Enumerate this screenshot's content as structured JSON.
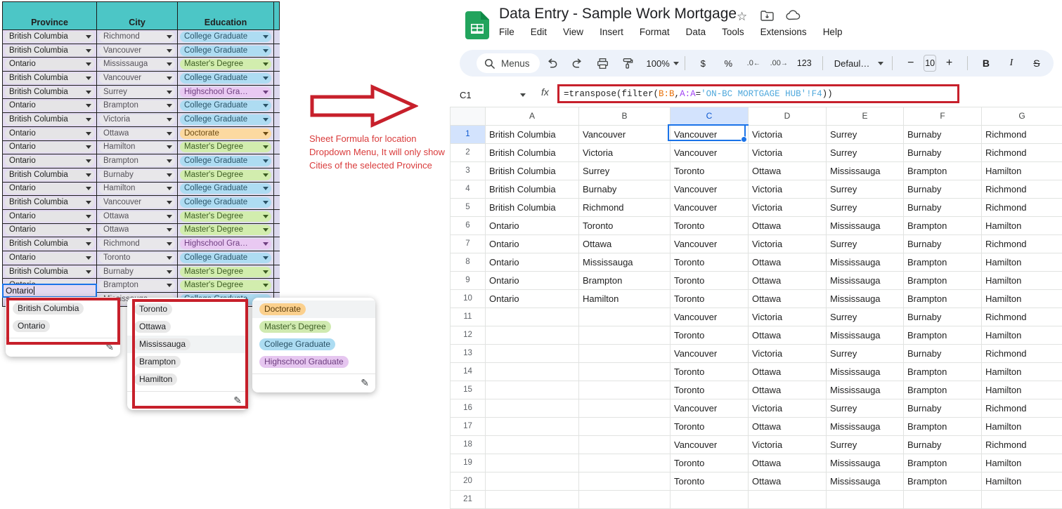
{
  "form_table": {
    "headers": [
      "Province",
      "City",
      "Education"
    ],
    "rows": [
      {
        "province": "British Columbia",
        "city": "Richmond",
        "education": "College Graduate",
        "edu_color": "blue"
      },
      {
        "province": "British Columbia",
        "city": "Vancouver",
        "education": "College Graduate",
        "edu_color": "blue"
      },
      {
        "province": "Ontario",
        "city": "Mississauga",
        "education": "Master's Degree",
        "edu_color": "green"
      },
      {
        "province": "British Columbia",
        "city": "Vancouver",
        "education": "College Graduate",
        "edu_color": "blue"
      },
      {
        "province": "British Columbia",
        "city": "Surrey",
        "education": "Highschool Gra…",
        "edu_color": "purple"
      },
      {
        "province": "Ontario",
        "city": "Brampton",
        "education": "College Graduate",
        "edu_color": "blue"
      },
      {
        "province": "British Columbia",
        "city": "Victoria",
        "education": "College Graduate",
        "edu_color": "blue"
      },
      {
        "province": "Ontario",
        "city": "Ottawa",
        "education": "Doctorate",
        "edu_color": "orange"
      },
      {
        "province": "Ontario",
        "city": "Hamilton",
        "education": "Master's Degree",
        "edu_color": "green"
      },
      {
        "province": "Ontario",
        "city": "Brampton",
        "education": "College Graduate",
        "edu_color": "blue"
      },
      {
        "province": "British Columbia",
        "city": "Burnaby",
        "education": "Master's Degree",
        "edu_color": "green"
      },
      {
        "province": "Ontario",
        "city": "Hamilton",
        "education": "College Graduate",
        "edu_color": "blue"
      },
      {
        "province": "British Columbia",
        "city": "Vancouver",
        "education": "College Graduate",
        "edu_color": "blue"
      },
      {
        "province": "Ontario",
        "city": "Ottawa",
        "education": "Master's Degree",
        "edu_color": "green"
      },
      {
        "province": "Ontario",
        "city": "Ottawa",
        "education": "Master's Degree",
        "edu_color": "green"
      },
      {
        "province": "British Columbia",
        "city": "Richmond",
        "education": "Highschool Gra…",
        "edu_color": "purple"
      },
      {
        "province": "Ontario",
        "city": "Toronto",
        "education": "College Graduate",
        "edu_color": "blue"
      },
      {
        "province": "British Columbia",
        "city": "Burnaby",
        "education": "Master's Degree",
        "edu_color": "green"
      },
      {
        "province": "Ontario",
        "city": "Brampton",
        "education": "Master's Degree",
        "edu_color": "green"
      }
    ],
    "editing_row": {
      "province_value": "Ontario",
      "city": "Mississauga",
      "education": "College Graduate",
      "edu_color": "blue"
    }
  },
  "province_dropdown": {
    "options": [
      "British Columbia",
      "Ontario"
    ],
    "highlighted_index": -1
  },
  "city_dropdown": {
    "options": [
      "Toronto",
      "Ottawa",
      "Mississauga",
      "Brampton",
      "Hamilton"
    ],
    "highlighted_index": 2
  },
  "education_dropdown": {
    "options": [
      {
        "label": "Doctorate",
        "color": "orange"
      },
      {
        "label": "Master's Degree",
        "color": "green"
      },
      {
        "label": "College Graduate",
        "color": "blue"
      },
      {
        "label": "Highschool Graduate",
        "color": "purple"
      }
    ],
    "highlighted_index": 0
  },
  "annotation": {
    "text": "Sheet Formula for location Dropdown Menu, It will only show Cities of the selected Province",
    "color": "#D93B3B"
  },
  "sheets": {
    "doc_title": "Data Entry - Sample Work Mortgage",
    "title_icons": [
      "star-icon",
      "move-to-folder-icon",
      "cloud-saved-icon"
    ],
    "menus": [
      "File",
      "Edit",
      "View",
      "Insert",
      "Format",
      "Data",
      "Tools",
      "Extensions",
      "Help"
    ],
    "toolbar": {
      "search_label": "Menus",
      "undo": "undo-icon",
      "redo": "redo-icon",
      "print": "print-icon",
      "paint_format": "paint-format-icon",
      "zoom": "100%",
      "currency": "$",
      "percent": "%",
      "decrease_decimal": ".0",
      "increase_decimal": ".00",
      "number_format": "123",
      "font": "Defaul…",
      "decrease_font": "−",
      "font_size": "10",
      "increase_font": "+",
      "bold": "B",
      "italic": "I",
      "strikethrough": "S"
    },
    "name_box": "C1",
    "fx_label": "fx",
    "formula": {
      "full": "=transpose(filter(B:B,A:A='ON-BC MORTGAGE HUB'!F4))",
      "parts": [
        {
          "t": "=transpose(filter(",
          "c": "plain"
        },
        {
          "t": "B:B",
          "c": "orange"
        },
        {
          "t": ",",
          "c": "plain"
        },
        {
          "t": "A:A",
          "c": "purple"
        },
        {
          "t": "=",
          "c": "plain"
        },
        {
          "t": "'ON-BC MORTGAGE HUB'!F4",
          "c": "blue"
        },
        {
          "t": "))",
          "c": "plain"
        }
      ]
    },
    "grid": {
      "columns": [
        "A",
        "B",
        "C",
        "D",
        "E",
        "F",
        "G"
      ],
      "selected_column": "C",
      "selected_row": 1,
      "selected_cell": "C1",
      "row_numbers": [
        1,
        2,
        3,
        4,
        5,
        6,
        7,
        8,
        9,
        10,
        11,
        12,
        13,
        14,
        15,
        16,
        17,
        18,
        19,
        20,
        21
      ],
      "rows": [
        [
          "British Columbia",
          "Vancouver",
          "Vancouver",
          "Victoria",
          "Surrey",
          "Burnaby",
          "Richmond"
        ],
        [
          "British Columbia",
          "Victoria",
          "Vancouver",
          "Victoria",
          "Surrey",
          "Burnaby",
          "Richmond"
        ],
        [
          "British Columbia",
          "Surrey",
          "Toronto",
          "Ottawa",
          "Mississauga",
          "Brampton",
          "Hamilton"
        ],
        [
          "British Columbia",
          "Burnaby",
          "Vancouver",
          "Victoria",
          "Surrey",
          "Burnaby",
          "Richmond"
        ],
        [
          "British Columbia",
          "Richmond",
          "Vancouver",
          "Victoria",
          "Surrey",
          "Burnaby",
          "Richmond"
        ],
        [
          "Ontario",
          "Toronto",
          "Toronto",
          "Ottawa",
          "Mississauga",
          "Brampton",
          "Hamilton"
        ],
        [
          "Ontario",
          "Ottawa",
          "Vancouver",
          "Victoria",
          "Surrey",
          "Burnaby",
          "Richmond"
        ],
        [
          "Ontario",
          "Mississauga",
          "Toronto",
          "Ottawa",
          "Mississauga",
          "Brampton",
          "Hamilton"
        ],
        [
          "Ontario",
          "Brampton",
          "Toronto",
          "Ottawa",
          "Mississauga",
          "Brampton",
          "Hamilton"
        ],
        [
          "Ontario",
          "Hamilton",
          "Toronto",
          "Ottawa",
          "Mississauga",
          "Brampton",
          "Hamilton"
        ],
        [
          "",
          "",
          "Vancouver",
          "Victoria",
          "Surrey",
          "Burnaby",
          "Richmond"
        ],
        [
          "",
          "",
          "Toronto",
          "Ottawa",
          "Mississauga",
          "Brampton",
          "Hamilton"
        ],
        [
          "",
          "",
          "Vancouver",
          "Victoria",
          "Surrey",
          "Burnaby",
          "Richmond"
        ],
        [
          "",
          "",
          "Toronto",
          "Ottawa",
          "Mississauga",
          "Brampton",
          "Hamilton"
        ],
        [
          "",
          "",
          "Toronto",
          "Ottawa",
          "Mississauga",
          "Brampton",
          "Hamilton"
        ],
        [
          "",
          "",
          "Vancouver",
          "Victoria",
          "Surrey",
          "Burnaby",
          "Richmond"
        ],
        [
          "",
          "",
          "Toronto",
          "Ottawa",
          "Mississauga",
          "Brampton",
          "Hamilton"
        ],
        [
          "",
          "",
          "Vancouver",
          "Victoria",
          "Surrey",
          "Burnaby",
          "Richmond"
        ],
        [
          "",
          "",
          "Toronto",
          "Ottawa",
          "Mississauga",
          "Brampton",
          "Hamilton"
        ],
        [
          "",
          "",
          "Toronto",
          "Ottawa",
          "Mississauga",
          "Brampton",
          "Hamilton"
        ],
        [
          "",
          "",
          "",
          "",
          "",
          "",
          ""
        ]
      ]
    }
  }
}
